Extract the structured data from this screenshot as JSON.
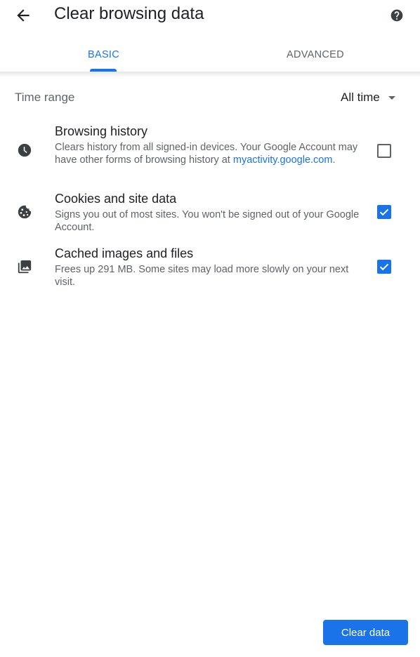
{
  "header": {
    "title": "Clear browsing data",
    "back_icon": "arrow-back-icon",
    "help_icon": "help-icon"
  },
  "tabs": [
    {
      "label": "BASIC",
      "selected": true
    },
    {
      "label": "ADVANCED",
      "selected": false
    }
  ],
  "time_range": {
    "label": "Time range",
    "value": "All time"
  },
  "items": [
    {
      "title": "Browsing history",
      "description": "Clears history from all signed-in devices. Your Google Account may have other forms of browsing history at ",
      "link": "myactivity.google.com",
      "link_suffix": ".",
      "icon": "clock-icon",
      "checked": false
    },
    {
      "title": "Cookies and site data",
      "description": "Signs you out of most sites. You won't be signed out of your Google Account.",
      "icon": "cookie-icon",
      "checked": true
    },
    {
      "title": "Cached images and files",
      "description": "Frees up 291 MB. Some sites may load more slowly on your next visit.",
      "icon": "images-icon",
      "checked": true
    }
  ],
  "footer": {
    "clear_button": "Clear data"
  },
  "colors": {
    "accent": "#1a73e8",
    "text_primary": "#202124",
    "text_secondary": "#5f6368"
  }
}
